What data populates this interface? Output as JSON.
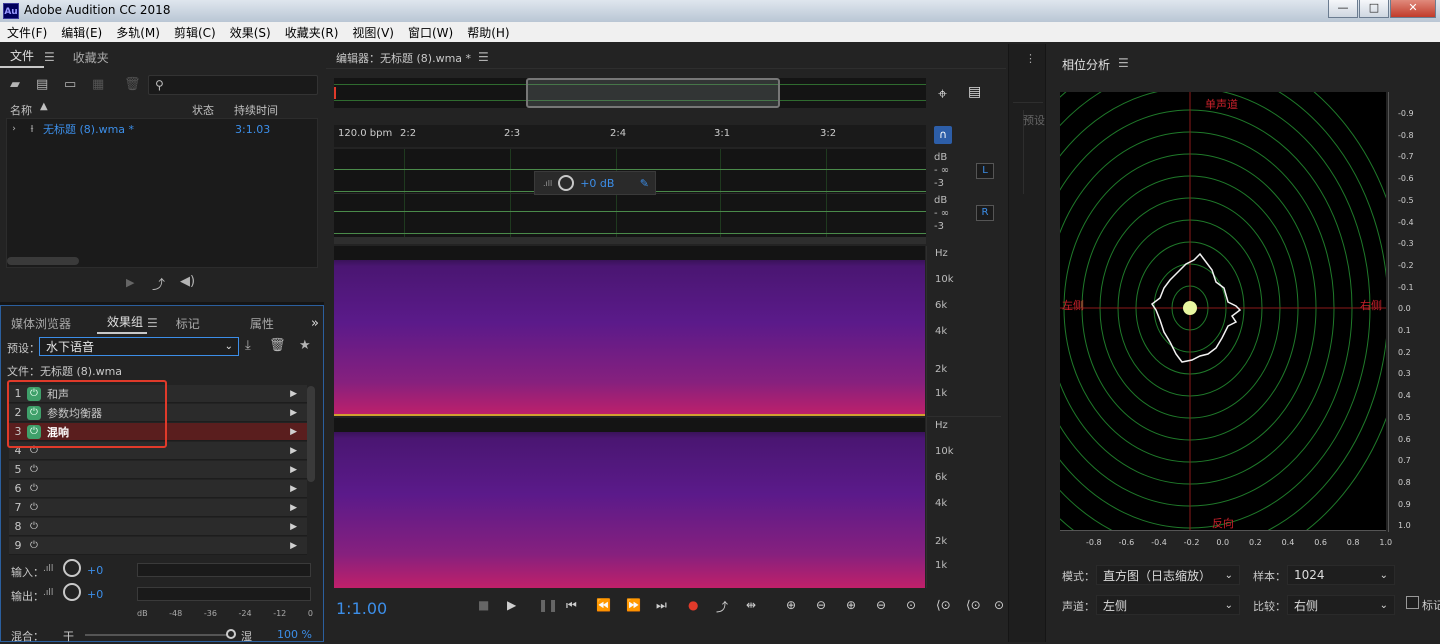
{
  "window": {
    "title": "Adobe Audition CC 2018",
    "logo": "Au",
    "min": "—",
    "max": "□",
    "close": "✕"
  },
  "menu": [
    "文件(F)",
    "编辑(E)",
    "多轨(M)",
    "剪辑(C)",
    "效果(S)",
    "收藏夹(R)",
    "视图(V)",
    "窗口(W)",
    "帮助(H)"
  ],
  "files_panel": {
    "tabs": [
      "文件",
      "收藏夹"
    ],
    "columns": {
      "name": "名称",
      "status": "状态",
      "duration": "持续时间"
    },
    "items": [
      {
        "name": "无标题 (8).wma *",
        "duration": "3:1.03"
      }
    ]
  },
  "effects_panel": {
    "tabs": [
      "媒体浏览器",
      "效果组",
      "标记",
      "属性"
    ],
    "preset_label": "预设：",
    "preset_value": "水下语音",
    "file_label": "文件：无标题 (8).wma",
    "slots": [
      {
        "num": "1",
        "name": "和声",
        "on": true
      },
      {
        "num": "2",
        "name": "参数均衡器",
        "on": true
      },
      {
        "num": "3",
        "name": "混响",
        "on": true
      },
      {
        "num": "4",
        "name": ""
      },
      {
        "num": "5",
        "name": ""
      },
      {
        "num": "6",
        "name": ""
      },
      {
        "num": "7",
        "name": ""
      },
      {
        "num": "8",
        "name": ""
      },
      {
        "num": "9",
        "name": ""
      }
    ],
    "input_label": "输入：",
    "input_value": "+0",
    "output_label": "输出：",
    "output_value": "+0",
    "meter_ticks": [
      "dB",
      "-48",
      "-36",
      "-24",
      "-12",
      "0"
    ],
    "mix_label": "混合：",
    "dry": "干",
    "wet": "湿",
    "mix_value": "100 %"
  },
  "editor": {
    "title": "编辑器：无标题 (8).wma *",
    "bpm": "120.0 bpm",
    "ruler": [
      "2:2",
      "2:3",
      "2:4",
      "3:1",
      "3:2"
    ],
    "gain": "+0 dB",
    "db_labels": [
      "dB",
      "- ∞",
      "-3"
    ],
    "ch_left": "L",
    "ch_right": "R",
    "hz_labels": [
      "Hz",
      "10k",
      "6k",
      "4k",
      "2k",
      "1k"
    ],
    "time": "1:1.00",
    "preset_side": "预设"
  },
  "phase": {
    "title": "相位分析",
    "top_label": "单声道",
    "left_label": "左侧",
    "right_label": "右侧",
    "bottom_label": "反向",
    "y_axis": [
      "-0.9",
      "-0.8",
      "-0.7",
      "-0.6",
      "-0.5",
      "-0.4",
      "-0.3",
      "-0.2",
      "-0.1",
      "0.0",
      "0.1",
      "0.2",
      "0.3",
      "0.4",
      "0.5",
      "0.6",
      "0.7",
      "0.8",
      "0.9",
      "1.0"
    ],
    "x_axis": [
      "-0.8",
      "-0.6",
      "-0.4",
      "-0.2",
      "0.0",
      "0.2",
      "0.4",
      "0.6",
      "0.8",
      "1.0"
    ],
    "mode_label": "模式：",
    "mode_value": "直方图（日志缩放）",
    "samples_label": "样本：",
    "samples_value": "1024",
    "channel_label": "声道：",
    "channel_value": "左侧",
    "compare_label": "比较：",
    "compare_value": "右侧",
    "checkbox_label": "标记"
  },
  "colors": {
    "accent": "#3c8ee8",
    "power_on": "#3fa06a",
    "highlight_box": "#e03a2a",
    "spectrum_top": "#5a1a8c",
    "spectrum_bottom": "#c0206a"
  }
}
